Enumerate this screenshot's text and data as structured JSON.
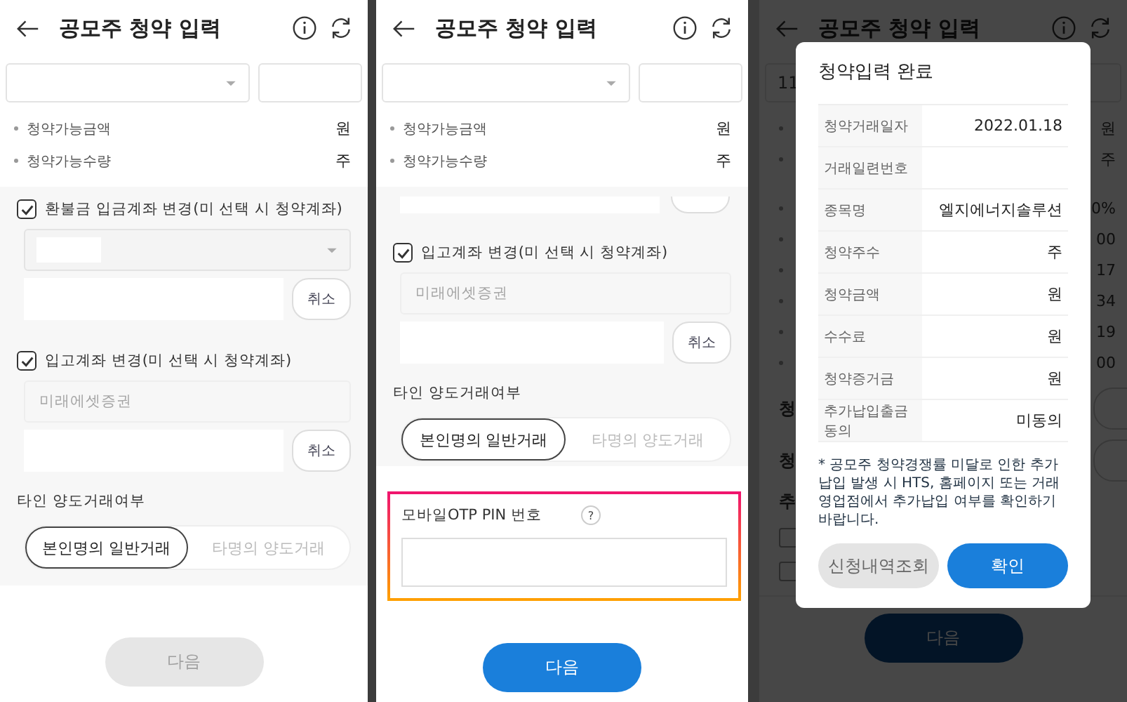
{
  "panels": [
    {
      "kind": "form",
      "header": {
        "title": "공모주 청약 입력"
      },
      "summary": [
        {
          "label": "청약가능금액",
          "value": "원"
        },
        {
          "label": "청약가능수량",
          "value": "주"
        }
      ],
      "sections": [
        {
          "kind": "account",
          "checkbox": {
            "label": "환불금 입금계좌 변경(미 선택 시 청약계좌)",
            "checked": true
          },
          "select": {
            "masked": true
          },
          "cancel": "취소"
        },
        {
          "kind": "account",
          "checkbox": {
            "label": "입고계좌 변경(미 선택 시 청약계좌)",
            "checked": true
          },
          "broker": {
            "placeholder": "미래에셋증권"
          },
          "cancel": "취소"
        },
        {
          "kind": "transfer",
          "label": "타인 양도거래여부",
          "options": [
            {
              "label": "본인명의 일반거래",
              "selected": true
            },
            {
              "label": "타명의 양도거래",
              "selected": false
            }
          ]
        }
      ],
      "next": {
        "label": "다음",
        "disabled": true
      }
    },
    {
      "kind": "form",
      "header": {
        "title": "공모주 청약 입력"
      },
      "summary": [
        {
          "label": "청약가능금액",
          "value": "원"
        },
        {
          "label": "청약가능수량",
          "value": "주"
        }
      ],
      "sections": [
        {
          "kind": "stub"
        },
        {
          "kind": "account",
          "checkbox": {
            "label": "입고계좌 변경(미 선택 시 청약계좌)",
            "checked": true
          },
          "broker": {
            "placeholder": "미래에셋증권"
          },
          "cancel": "취소"
        },
        {
          "kind": "transfer",
          "label": "타인 양도거래여부",
          "options": [
            {
              "label": "본인명의 일반거래",
              "selected": true
            },
            {
              "label": "타명의 양도거래",
              "selected": false
            }
          ]
        },
        {
          "kind": "otp",
          "label": "모바일OTP PIN 번호",
          "help": "?",
          "highlighted": true
        }
      ],
      "next": {
        "label": "다음",
        "disabled": false
      }
    },
    {
      "kind": "dialog",
      "header": {
        "title": "공모주 청약 입력"
      },
      "background": {
        "select_value": "11",
        "rows": [
          {
            "value": "원"
          },
          {
            "value": "주"
          },
          {
            "value": "0%"
          },
          {
            "value": "00"
          },
          {
            "value": "17"
          },
          {
            "value": "34"
          },
          {
            "value": "19"
          },
          {
            "value": "00"
          }
        ],
        "options": [
          {
            "label": "청"
          },
          {
            "label": "청"
          }
        ],
        "extra_label": "추",
        "checkboxes": [
          {
            "checked": false
          },
          {
            "checked": false
          }
        ],
        "next": {
          "label": "다음"
        }
      },
      "dialog": {
        "title": "청약입력 완료",
        "rows": [
          {
            "label": "청약거래일자",
            "value": "2022.01.18"
          },
          {
            "label": "거래일련번호"
          },
          {
            "label": "종목명",
            "value": "엘지에너지솔루션"
          },
          {
            "label": "청약주수",
            "value": "주"
          },
          {
            "label": "청약금액",
            "value": "원"
          },
          {
            "label": "수수료",
            "value": "원"
          },
          {
            "label": "청약증거금",
            "value": "원"
          },
          {
            "label": "추가납입출금 동의",
            "value": "미동의"
          }
        ],
        "note": "* 공모주 청약경쟁률 미달로 인한 추가납입 발생 시 HTS, 홈페이지 또는 거래 영업점에서 추가납입 여부를 확인하기 바랍니다.",
        "buttons": [
          {
            "label": "신청내역조회",
            "kind": "secondary"
          },
          {
            "label": "확인",
            "kind": "primary"
          }
        ]
      }
    }
  ]
}
